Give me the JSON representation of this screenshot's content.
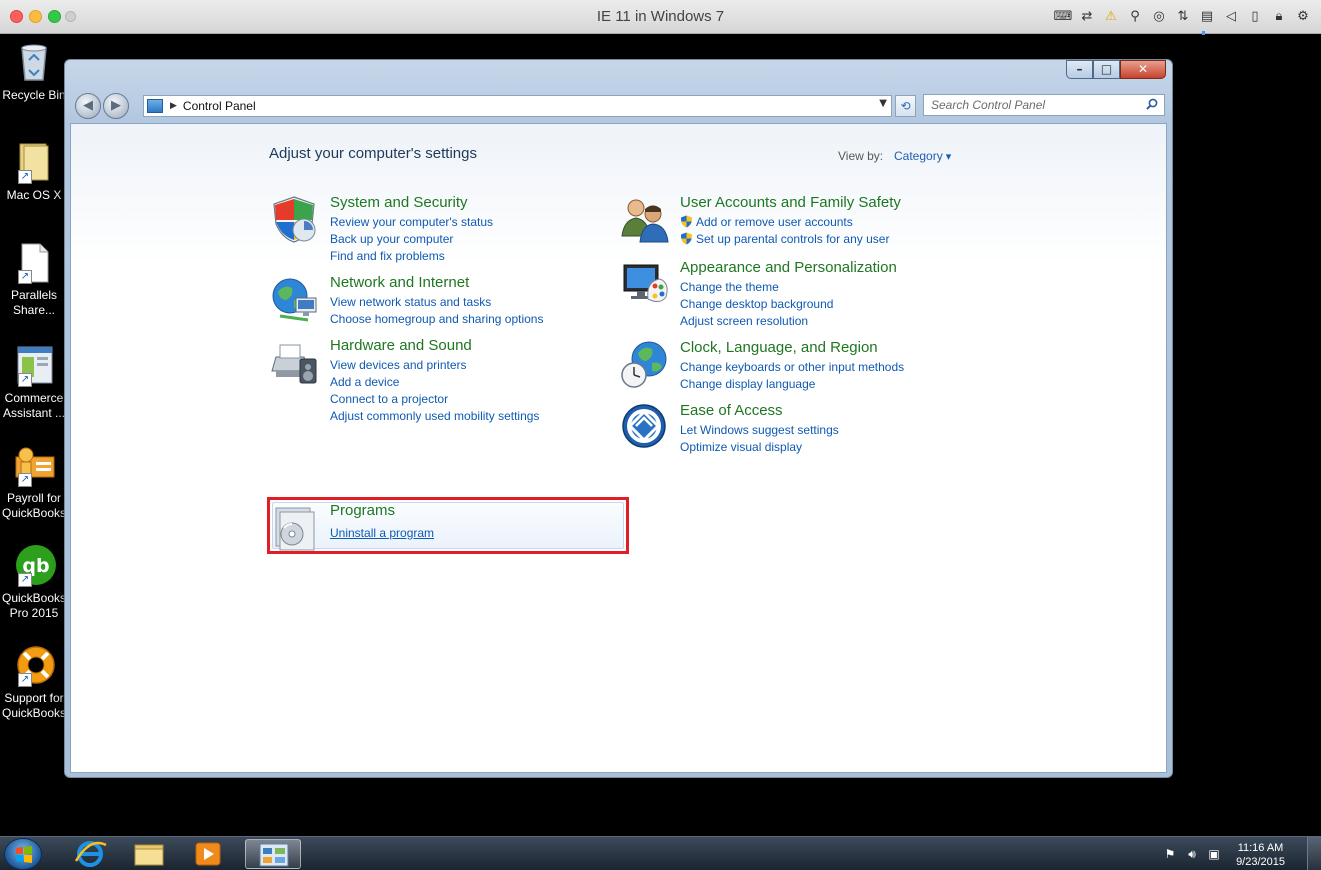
{
  "host": {
    "title": "IE 11 in Windows 7"
  },
  "desktop": {
    "icons": [
      {
        "label": "Recycle Bin"
      },
      {
        "label": "Mac OS X"
      },
      {
        "label": "Parallels\nShare..."
      },
      {
        "label": "Commerce\nAssistant ..."
      },
      {
        "label": "Payroll for\nQuickBooks"
      },
      {
        "label": "QuickBooks\nPro 2015"
      },
      {
        "label": "Support for\nQuickBooks"
      }
    ]
  },
  "window": {
    "address": {
      "location": "Control Panel"
    },
    "search": {
      "placeholder": "Search Control Panel"
    },
    "content": {
      "title": "Adjust your computer's settings",
      "view_by_label": "View by:",
      "view_by_value": "Category",
      "categories": [
        {
          "title": "System and Security",
          "icon": "shield-icon",
          "links": [
            "Review your computer's status",
            "Back up your computer",
            "Find and fix problems"
          ]
        },
        {
          "title": "Network and Internet",
          "icon": "network-globe-icon",
          "links": [
            "View network status and tasks",
            "Choose homegroup and sharing options"
          ]
        },
        {
          "title": "Hardware and Sound",
          "icon": "printer-speaker-icon",
          "links": [
            "View devices and printers",
            "Add a device",
            "Connect to a projector",
            "Adjust commonly used mobility settings"
          ]
        },
        {
          "title": "Programs",
          "icon": "programs-disc-icon",
          "links": [
            "Uninstall a program"
          ]
        },
        {
          "title": "User Accounts and Family Safety",
          "icon": "users-icon",
          "links": [
            "Add or remove user accounts",
            "Set up parental controls for any user"
          ]
        },
        {
          "title": "Appearance and Personalization",
          "icon": "monitor-palette-icon",
          "links": [
            "Change the theme",
            "Change desktop background",
            "Adjust screen resolution"
          ]
        },
        {
          "title": "Clock, Language, and Region",
          "icon": "clock-globe-icon",
          "links": [
            "Change keyboards or other input methods",
            "Change display language"
          ]
        },
        {
          "title": "Ease of Access",
          "icon": "ease-of-access-icon",
          "links": [
            "Let Windows suggest settings",
            "Optimize visual display"
          ]
        }
      ]
    }
  },
  "taskbar": {
    "clock_time": "11:16 AM",
    "clock_date": "9/23/2015"
  },
  "colors": {
    "category_title": "#1f7722",
    "link": "#0f5ab3",
    "highlight": "#e21d25"
  }
}
